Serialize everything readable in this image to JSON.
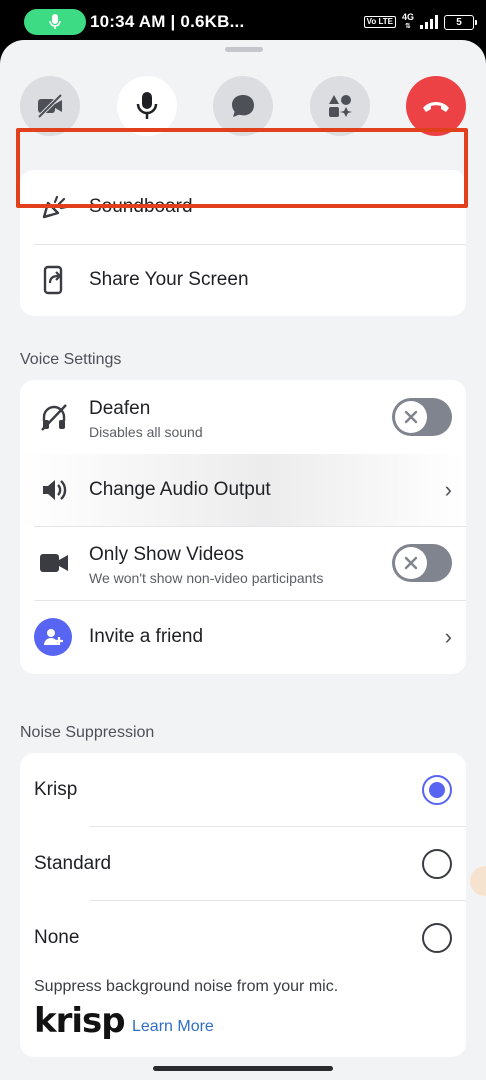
{
  "status": {
    "time_text": "10:34 AM | 0.6KB...",
    "volte": "Vo LTE",
    "network": "4G",
    "battery": "5"
  },
  "actions": {
    "soundboard": "Soundboard",
    "share_screen": "Share Your Screen"
  },
  "voice_settings": {
    "title": "Voice Settings",
    "deafen": {
      "label": "Deafen",
      "sub": "Disables all sound",
      "enabled": false
    },
    "audio_output": {
      "label": "Change Audio Output"
    },
    "only_videos": {
      "label": "Only Show Videos",
      "sub": "We won't show non-video participants",
      "enabled": false
    },
    "invite": {
      "label": "Invite a friend"
    }
  },
  "noise_suppression": {
    "title": "Noise Suppression",
    "options": [
      "Krisp",
      "Standard",
      "None"
    ],
    "selected": "Krisp",
    "description": "Suppress background noise from your mic.",
    "brand": "krisp",
    "learn_more": "Learn More"
  },
  "colors": {
    "accent": "#5865f2",
    "danger": "#ed4245",
    "highlight": "#e2401c"
  }
}
